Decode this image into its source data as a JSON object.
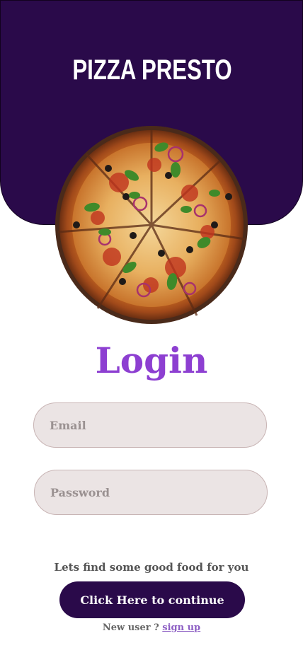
{
  "header": {
    "title": "PIZZA PRESTO",
    "background_color": "#2a0a4a"
  },
  "hero": {
    "image": "pizza-image"
  },
  "login": {
    "title": "Login",
    "title_color": "#8d3fd1",
    "email_placeholder": "Email",
    "password_placeholder": "Password",
    "tagline": "Lets find some good food for you",
    "continue_label": "Click Here to continue",
    "new_user_text": "New user ?",
    "signup_label": "sign up",
    "signup_color": "#8d5fc4"
  }
}
